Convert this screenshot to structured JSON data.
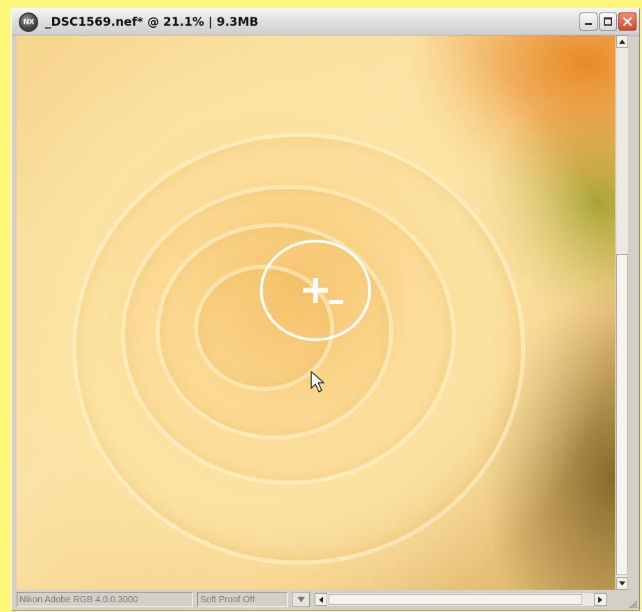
{
  "window": {
    "title": "_DSC1569.nef* @ 21.1% | 9.3MB",
    "app_icon_text": "NX",
    "buttons": {
      "minimize": "minimize-icon",
      "maximize": "maximize-icon",
      "close": "close-icon"
    }
  },
  "canvas": {
    "image_subject": "yellow rose photo",
    "cursor_icon": "zoom-plus-minus-icon",
    "pointer_icon": "arrow-pointer-icon"
  },
  "statusbar": {
    "profile": "Nikon Adobe RGB 4.0.0.3000",
    "soft_proof": "Soft Proof Off",
    "dropdown_icon": "triangle-down-icon"
  },
  "colors": {
    "background": "#fdf87a",
    "window_chrome": "#d4d0c8",
    "close_button": "#d44a2a",
    "rose_tone": "#fbd48a"
  }
}
